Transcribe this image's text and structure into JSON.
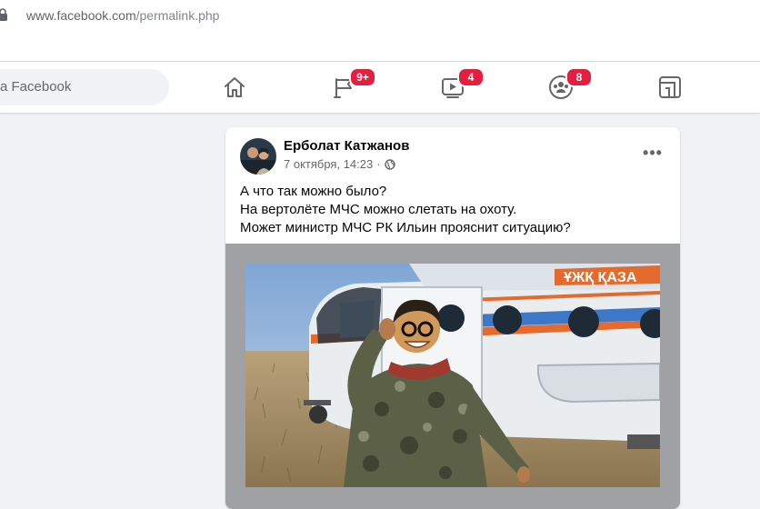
{
  "browser": {
    "url_host": "www.facebook.com",
    "url_path": "/permalink.php"
  },
  "topbar": {
    "search_placeholder": "а Facebook",
    "nav": [
      {
        "name": "home",
        "icon": "home-icon",
        "badge": ""
      },
      {
        "name": "pages",
        "icon": "flag-icon",
        "badge": "9+"
      },
      {
        "name": "watch",
        "icon": "video-icon",
        "badge": "4"
      },
      {
        "name": "groups",
        "icon": "groups-icon",
        "badge": "8"
      },
      {
        "name": "gaming",
        "icon": "gaming-icon",
        "badge": ""
      }
    ]
  },
  "post": {
    "author": "Ерболат Катжанов",
    "timestamp": "7 октября, 14:23",
    "privacy_icon": "globe-icon",
    "more_label": "•••",
    "lines": [
      "А что так можно было?",
      "На вертолёте МЧС можно слетать на охоту.",
      "Может министр МЧС РК Ильин прояснит ситуацию?"
    ],
    "photo_alt": "Man in camouflage jacket in front of an orange-and-white helicopter on a steppe",
    "helicopter_text": "ҰЖҚ ҚАЗА"
  },
  "colors": {
    "badge": "#e41e3f",
    "icon": "#65676b",
    "background": "#f0f2f5"
  }
}
